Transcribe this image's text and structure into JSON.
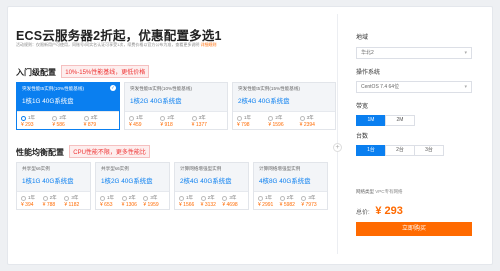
{
  "header": {
    "title": "ECS云服务器2折起，优惠配置多选1",
    "notice_prefix": "活动规则：仅限新用户可使用，同账号/同实名认证可享受1次，续费价格以官方公布为准，查看更多说明",
    "notice_link": "详细规则"
  },
  "entry": {
    "title": "入门级配置",
    "tag": "10%-15%性能基线，更低价格",
    "years": [
      "1年",
      "2年",
      "3年"
    ],
    "products": [
      {
        "name": "突发性能t5实例(10%性能基线)",
        "spec": "1核1G 40G系统盘",
        "prices": [
          "¥ 293",
          "¥ 586",
          "¥ 879"
        ],
        "selected": true
      },
      {
        "name": "突发性能t5实例(10%性能基线)",
        "spec": "1核2G 40G系统盘",
        "prices": [
          "¥ 459",
          "¥ 918",
          "¥ 1377"
        ],
        "selected": false
      },
      {
        "name": "突发性能t5实例(15%性能基线)",
        "spec": "2核4G 40G系统盘",
        "prices": [
          "¥ 798",
          "¥ 1596",
          "¥ 2394"
        ],
        "selected": false
      }
    ]
  },
  "balanced": {
    "title": "性能均衡配置",
    "tag": "CPU性能不限，更多性能比",
    "years": [
      "1年",
      "2年",
      "3年"
    ],
    "products": [
      {
        "name": "共享型s6实例",
        "spec": "1核1G 40G系统盘",
        "prices": [
          "¥ 394",
          "¥ 788",
          "¥ 1182"
        ],
        "selected": false
      },
      {
        "name": "共享型s6实例",
        "spec": "1核2G 40G系统盘",
        "prices": [
          "¥ 653",
          "¥ 1306",
          "¥ 1959"
        ],
        "selected": false
      },
      {
        "name": "计算网络增强型实例",
        "spec": "2核4G 40G系统盘",
        "prices": [
          "¥ 1566",
          "¥ 3132",
          "¥ 4698"
        ],
        "selected": false
      },
      {
        "name": "计算网络增强型实例",
        "spec": "4核8G 40G系统盘",
        "prices": [
          "¥ 2991",
          "¥ 5982",
          "¥ 7973"
        ],
        "selected": false
      }
    ]
  },
  "config": {
    "region_label": "地域",
    "region_value": "华北2",
    "os_label": "操作系统",
    "os_value": "CentOS 7.4 64位",
    "bandwidth_label": "带宽",
    "bandwidth_options": [
      "1M",
      "2M"
    ],
    "count_label": "台数",
    "count_options": [
      "1台",
      "2台",
      "3台"
    ],
    "network_label": "网络类型",
    "network_value": "VPC专有网络",
    "total_label": "总价:",
    "total_value": "¥ 293",
    "buy_label": "立即购买"
  },
  "colors": {
    "accent_blue": "#0a7ff0",
    "price_orange": "#ff6a00",
    "tag_red": "#e33"
  },
  "icons": {
    "check": "check-icon",
    "chevron": "chevron-down-icon",
    "plus": "plus-icon",
    "radio": "radio-icon"
  }
}
